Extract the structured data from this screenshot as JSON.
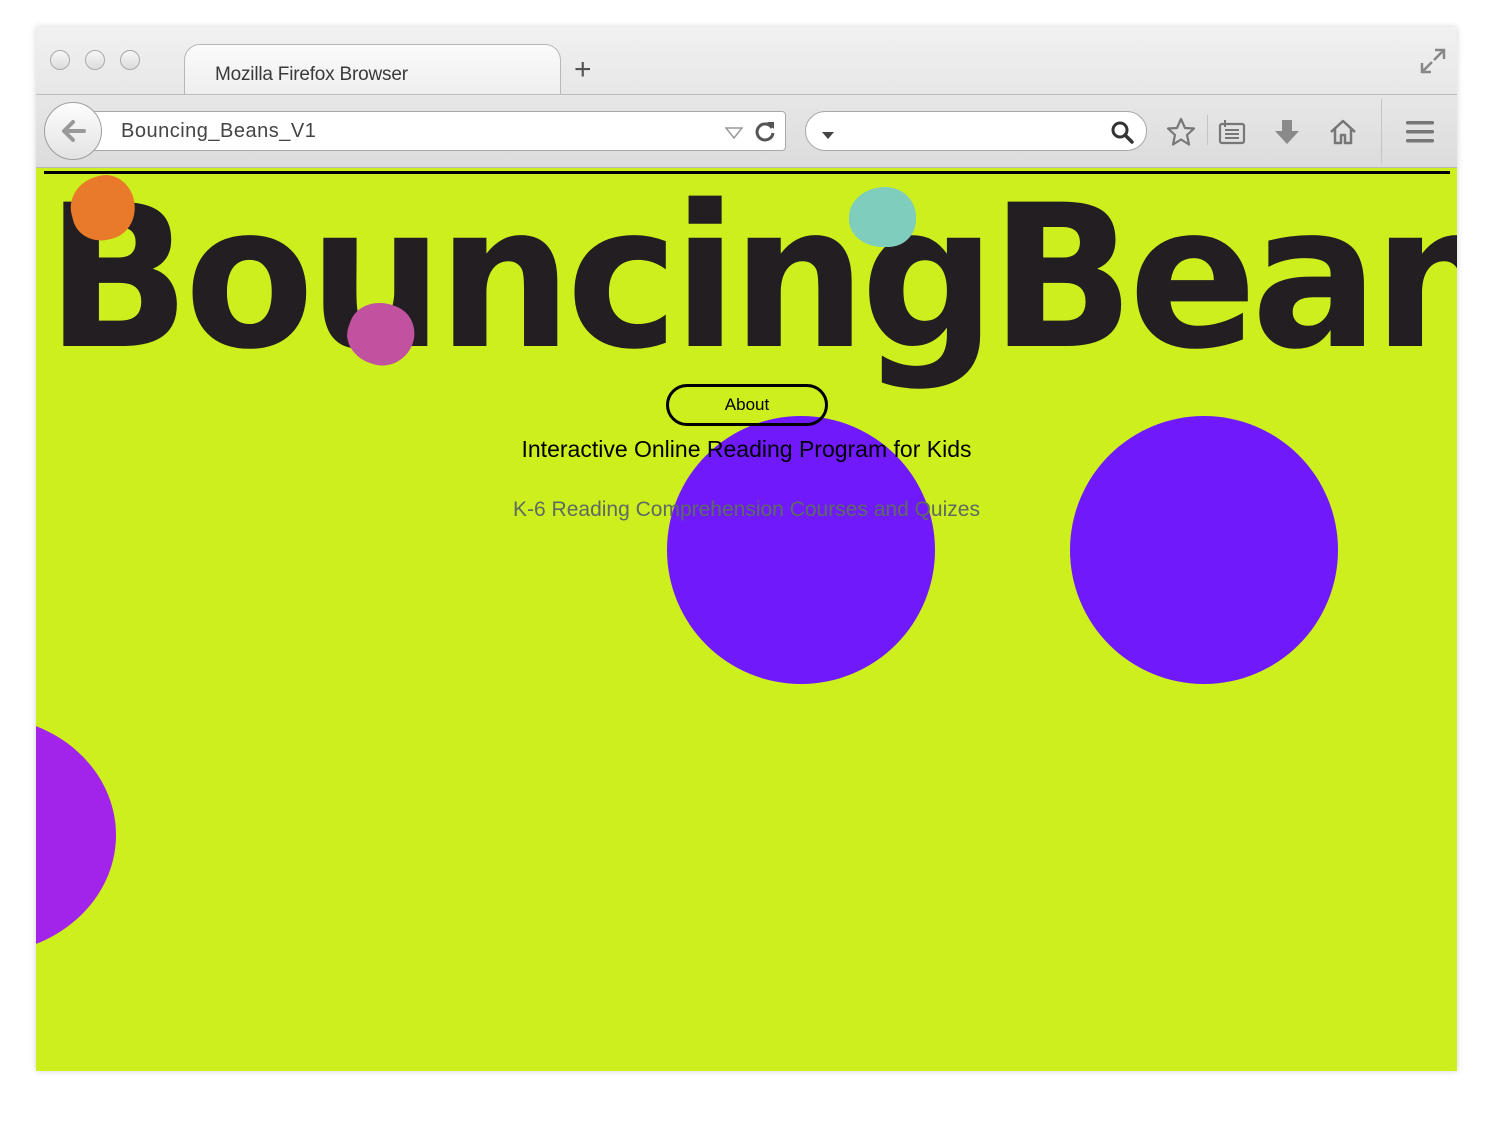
{
  "browser": {
    "tab_title": "Mozilla Firefox Browser",
    "new_tab_label": "+",
    "url": "Bouncing_Beans_V1",
    "search_placeholder": ""
  },
  "page": {
    "logo": "BouncingBeans",
    "about_label": "About",
    "tagline": "Interactive Online Reading Program for Kids",
    "subtagline": "K-6 Reading Comprehension Courses and Quizes"
  },
  "colors": {
    "background": "#cdef1e",
    "circle_primary": "#7019fb",
    "circle_secondary": "#a223e9",
    "bean_orange": "#e97a29",
    "bean_teal": "#7fcdbd",
    "bean_magenta": "#c052a0",
    "logo": "#221e21"
  },
  "icons": [
    "back-arrow-icon",
    "dropdown-icon",
    "reload-icon",
    "search-icon",
    "bookmark-star-icon",
    "reading-list-icon",
    "download-icon",
    "home-icon",
    "hamburger-menu-icon",
    "resize-icon"
  ]
}
